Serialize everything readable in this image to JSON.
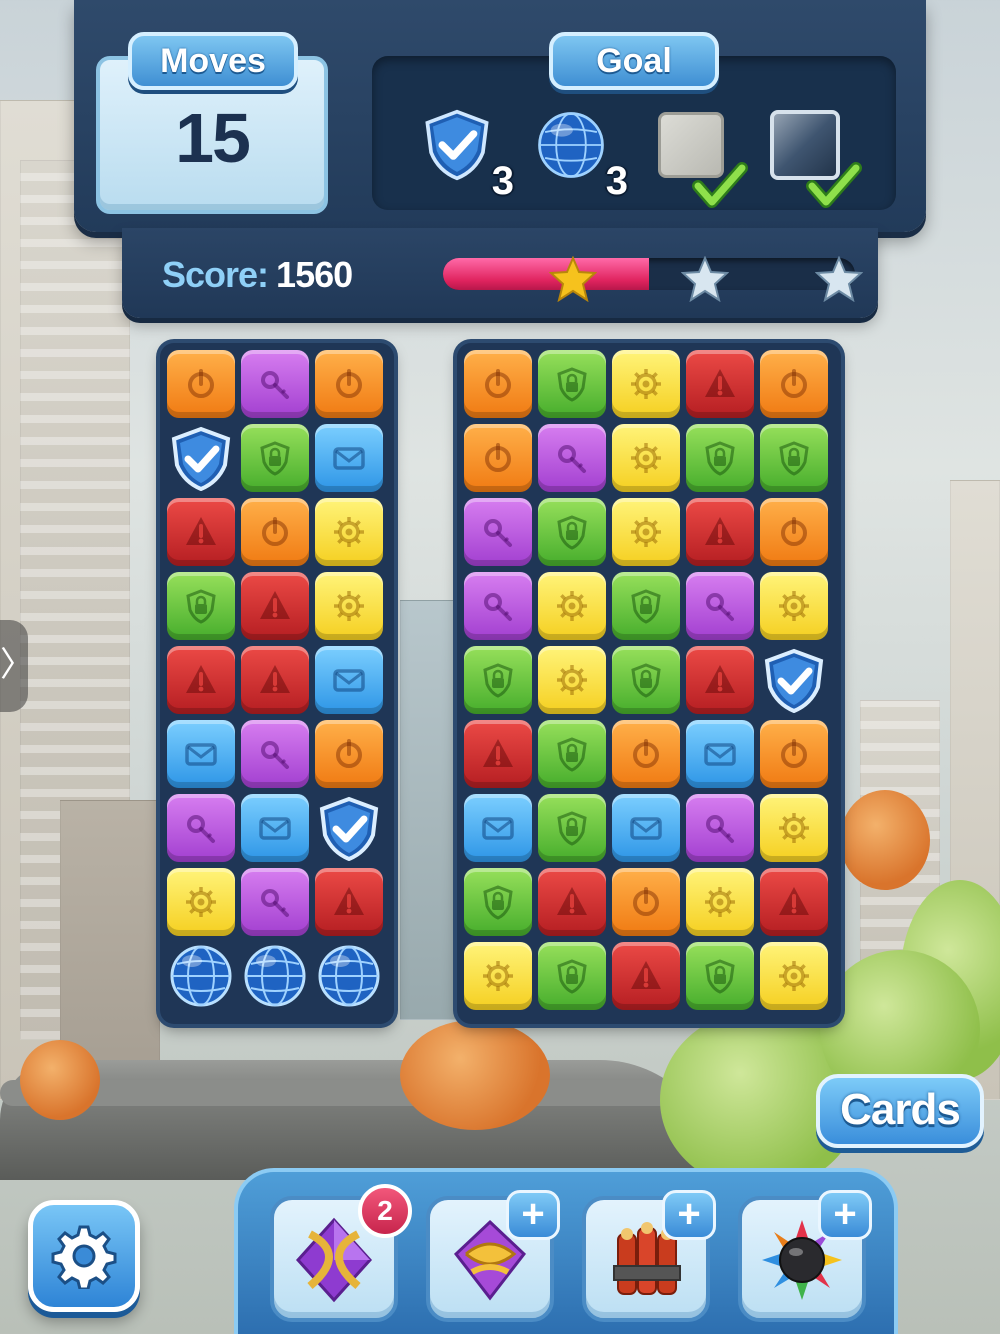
{
  "hud": {
    "moves_label": "Moves",
    "moves_value": "15",
    "goal_label": "Goal",
    "goals": [
      {
        "icon": "shield-check-icon",
        "count": "3",
        "complete": false
      },
      {
        "icon": "globe-icon",
        "count": "3",
        "complete": false
      },
      {
        "icon": "stone-tile-icon",
        "count": "",
        "complete": true
      },
      {
        "icon": "glass-tile-icon",
        "count": "",
        "complete": true
      }
    ],
    "score_label": "Score:",
    "score_value": "1560",
    "progress_fraction": 0.5,
    "stars": [
      {
        "earned": true
      },
      {
        "earned": false
      },
      {
        "earned": false
      }
    ]
  },
  "boards": {
    "left": {
      "columns": 3,
      "tiles": [
        "power",
        "key",
        "power",
        "shield",
        "lock",
        "mail",
        "alert",
        "power",
        "gear",
        "lock",
        "alert",
        "gear",
        "alert",
        "alert",
        "mail",
        "mail",
        "key",
        "power",
        "key",
        "mail",
        "shield",
        "gear",
        "key",
        "alert",
        "globe",
        "globe",
        "globe"
      ]
    },
    "right": {
      "columns": 5,
      "tiles": [
        "power",
        "lock",
        "gear",
        "alert",
        "power",
        "power",
        "key",
        "gear",
        "lock",
        "lock",
        "key",
        "lock",
        "gear",
        "alert",
        "power",
        "key",
        "gear",
        "lock",
        "key",
        "gear",
        "lock",
        "gear",
        "lock",
        "alert",
        "shield",
        "alert",
        "lock",
        "power",
        "mail",
        "power",
        "mail",
        "lock",
        "mail",
        "key",
        "gear",
        "lock",
        "alert",
        "power",
        "gear",
        "alert",
        "gear",
        "lock",
        "alert",
        "lock",
        "gear"
      ]
    }
  },
  "tile_colors": {
    "power": "orange",
    "key": "purple",
    "lock": "green",
    "mail": "blue",
    "alert": "red",
    "gear": "yellow"
  },
  "buttons": {
    "cards_label": "Cards",
    "settings_icon": "gear-icon",
    "side_handle_label": "〉"
  },
  "boosters": [
    {
      "icon": "spiral-gem-booster-icon",
      "badge": "2",
      "badge_type": "count"
    },
    {
      "icon": "hourglass-gem-booster-icon",
      "badge": "+",
      "badge_type": "plus"
    },
    {
      "icon": "dynamite-booster-icon",
      "badge": "+",
      "badge_type": "plus"
    },
    {
      "icon": "spiked-bomb-booster-icon",
      "badge": "+",
      "badge_type": "plus"
    }
  ],
  "colors": {
    "hud_navy": "#223b5a",
    "accent_blue": "#3f8fd3",
    "progress_pink": "#e0245f",
    "star_gold": "#f6c21d"
  }
}
